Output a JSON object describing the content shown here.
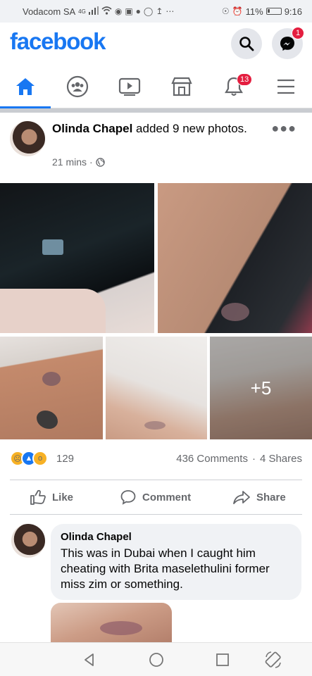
{
  "status_bar": {
    "carrier": "Vodacom SA",
    "network": "4G",
    "battery": "11%",
    "time": "9:16"
  },
  "header": {
    "logo": "facebook",
    "messenger_badge": "1"
  },
  "tabs": [
    {
      "name": "home",
      "icon": "home-icon",
      "active": true
    },
    {
      "name": "groups",
      "icon": "groups-icon"
    },
    {
      "name": "watch",
      "icon": "watch-icon"
    },
    {
      "name": "marketplace",
      "icon": "marketplace-icon"
    },
    {
      "name": "notifications",
      "icon": "bell-icon",
      "badge": "13"
    },
    {
      "name": "menu",
      "icon": "menu-icon"
    }
  ],
  "post": {
    "author": "Olinda Chapel",
    "action": "added 9 new photos.",
    "time": "21 mins",
    "privacy_icon": "globe-icon",
    "more_photos": "+5",
    "reaction_count": "129",
    "reactions": [
      "sad",
      "like",
      "wow"
    ],
    "comments": "436 Comments",
    "separator": "·",
    "shares": "4 Shares"
  },
  "actions": {
    "like": "Like",
    "comment": "Comment",
    "share": "Share"
  },
  "comment": {
    "author": "Olinda Chapel",
    "text": "This was in Dubai when I caught him cheating with Brita maselethulini former miss zim or something."
  },
  "colors": {
    "brand": "#1877f2",
    "badge": "#e41e3f",
    "secondary_text": "#65676b"
  }
}
